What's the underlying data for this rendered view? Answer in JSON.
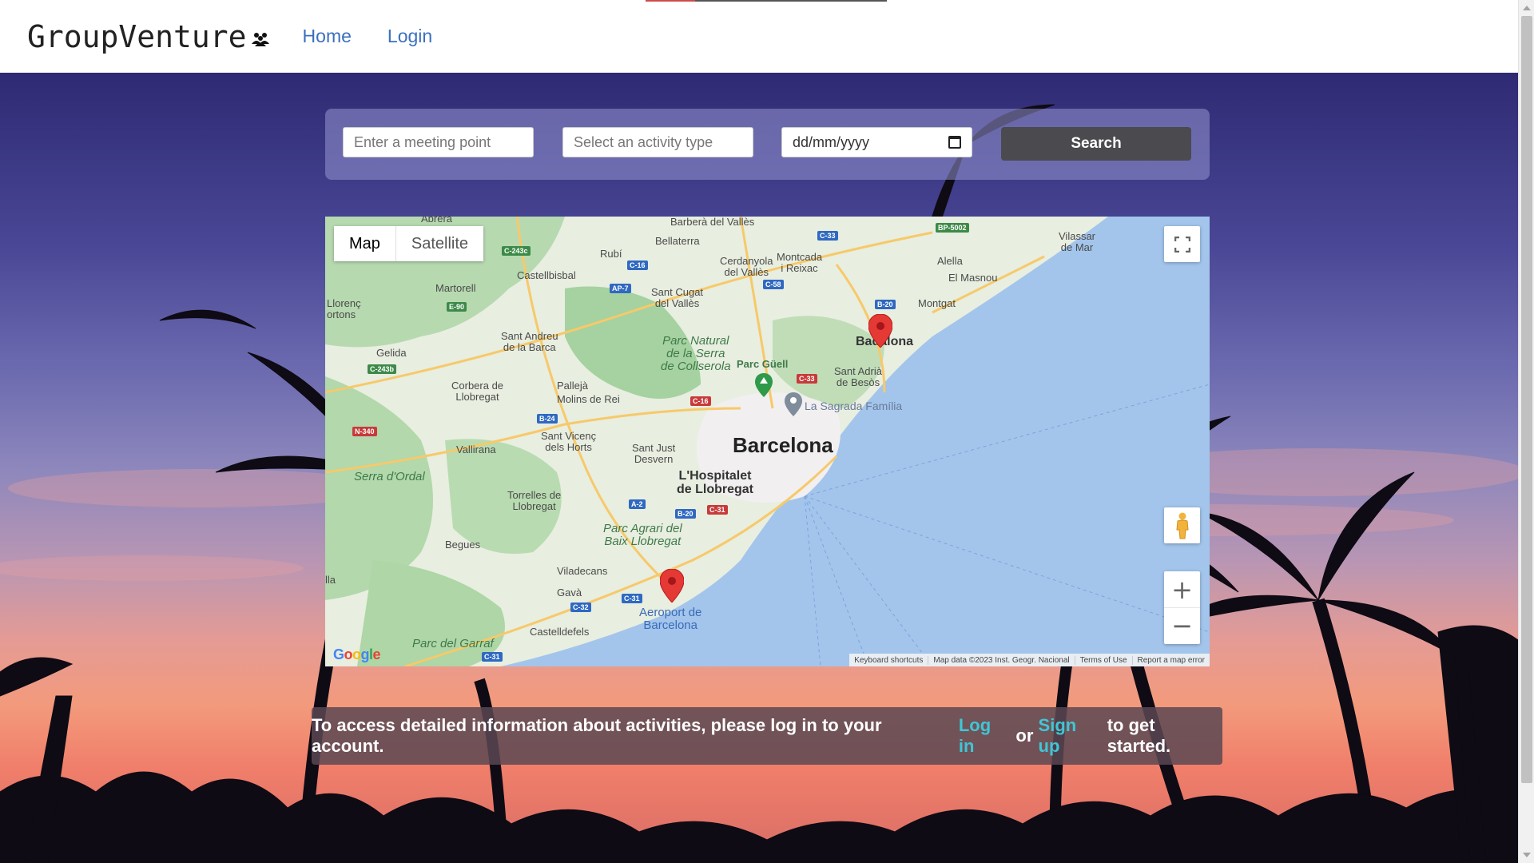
{
  "header": {
    "logo_text": "GroupVenture",
    "logo_icon": "group-icon",
    "nav": [
      {
        "label": "Home"
      },
      {
        "label": "Login"
      }
    ]
  },
  "search": {
    "meeting_point_placeholder": "Enter a meeting point",
    "activity_type_placeholder": "Select an activity type",
    "date_placeholder": "dd/mm/yyyy",
    "button_label": "Search"
  },
  "map": {
    "type_map": "Map",
    "type_satellite": "Satellite",
    "city": "Barcelona",
    "labels": {
      "abrera": "Abrera",
      "barbera": "Barberà\ndel Vallès",
      "rubi": "Rubí",
      "bellaterra": "Bellaterra",
      "cerdanyola": "Cerdanyola\ndel Vallès",
      "montcada": "Montcada\ni Reixac",
      "vilassar": "Vilassar\nde Mar",
      "alella": "Alella",
      "elmasnou": "El Masnou",
      "montgat": "Montgat",
      "martorell": "Martorell",
      "castellbisbal": "Castellbisbal",
      "santcugat": "Sant Cugat\ndel Vallès",
      "llorenc": "Llorenç\nortons",
      "santandreu": "Sant Andreu\nde la Barca",
      "collserola": "Parc Natural\nde la Serra\nde Collserola",
      "parcguell": "Parc Güell",
      "badalona": "Badalona",
      "santadria": "Sant Adrià\nde Besòs",
      "sagrada": "La Sagrada Família",
      "gelida": "Gelida",
      "corbera": "Corbera de\nLlobregat",
      "palleja": "Pallejà",
      "molins": "Molins de Rei",
      "santvicenc": "Sant Vicenç\ndels Horts",
      "santjust": "Sant Just\nDesvern",
      "vallirana": "Vallirana",
      "hospitalet": "L'Hospitalet\nde Llobregat",
      "serradordal": "Serra d'Ordal",
      "torrelles": "Torrelles de\nLlobregat",
      "parcagrari": "Parc Agrari del\nBaix Llobregat",
      "begues": "Begues",
      "viladecans": "Viladecans",
      "gava": "Gavà",
      "aeroport": "Aeroport de\nBarcelona",
      "castelldefels": "Castelldefels",
      "garraf": "Parc del Garraf",
      "lla": "lla"
    },
    "roads": [
      "C-243c",
      "C-16",
      "AP-7",
      "C-58",
      "C-33",
      "BP-5002",
      "B-20",
      "E-90",
      "C-243b",
      "C-33",
      "C-16",
      "B-24",
      "N-340",
      "A-2",
      "B-20",
      "C-31",
      "C-31",
      "C-32",
      "C-31"
    ],
    "google_logo": "Google",
    "footer": [
      "Keyboard shortcuts",
      "Map data ©2023 Inst. Geogr. Nacional",
      "Terms of Use",
      "Report a map error"
    ]
  },
  "info": {
    "text_before": "To access detailed information about activities, please log in to your account.",
    "login_link": "Log in",
    "or": "or",
    "signup_link": "Sign up",
    "text_after": "to get started."
  },
  "colors": {
    "accent_link": "#3fc6d6",
    "nav_link": "#3a6fbf",
    "search_button": "#4a4a4f",
    "pin": "#e53935"
  }
}
